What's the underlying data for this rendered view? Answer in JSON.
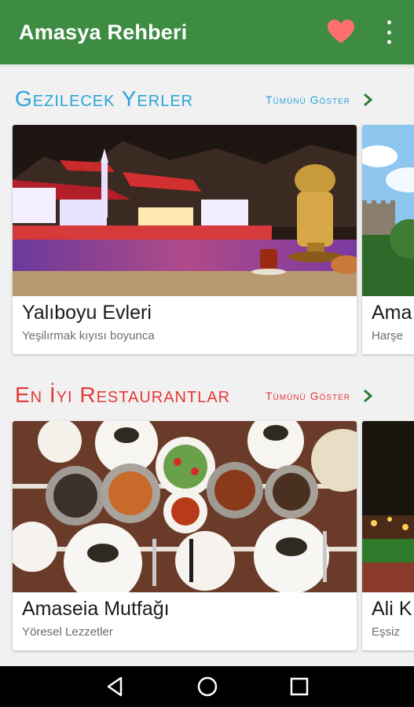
{
  "app": {
    "title": "Amasya Rehberi",
    "accent_color": "#3e8c43",
    "favorite_icon": "heart-icon",
    "menu_icon": "more-vert-icon"
  },
  "sections": [
    {
      "title": "Gezilecek Yerler",
      "title_color": "#2aa3d9",
      "show_all": "Tümünü Göster",
      "show_all_color": "#2aa3d9",
      "cards": [
        {
          "name": "Yalıboyu Evleri",
          "subtitle": "Yeşilırmak kıyısı boyunca"
        },
        {
          "name": "Ama",
          "subtitle": "Harşe"
        }
      ]
    },
    {
      "title": "En İyi Restaurantlar",
      "title_color": "#e53935",
      "show_all": "Tümünü Göster",
      "show_all_color": "#e53935",
      "cards": [
        {
          "name": "Amaseia Mutfağı",
          "subtitle": "Yöresel Lezzetler"
        },
        {
          "name": "Ali K",
          "subtitle": "Eşsiz"
        }
      ]
    }
  ],
  "navbar": {
    "back_icon": "back-icon",
    "home_icon": "home-icon",
    "recents_icon": "recents-icon"
  }
}
